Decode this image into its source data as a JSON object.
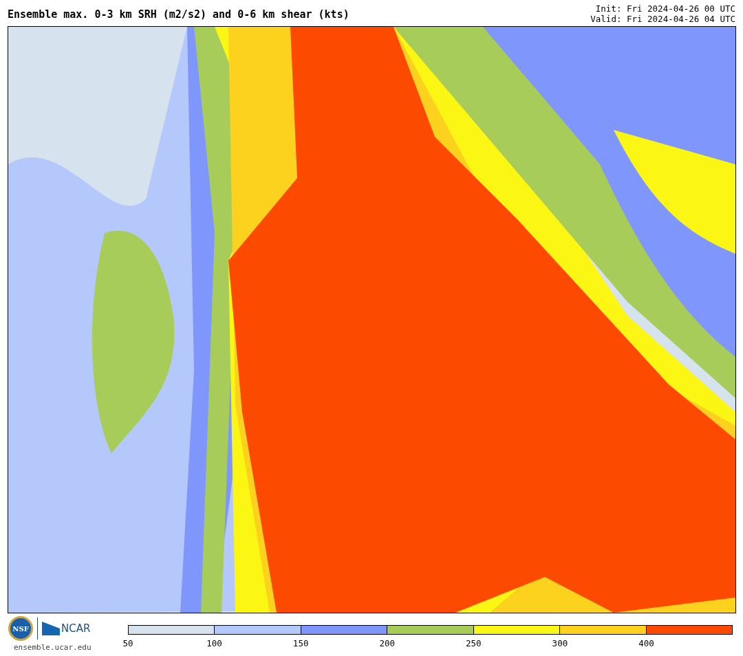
{
  "title": "Ensemble max. 0-3 km SRH (m2/s2) and 0-6 km shear (kts)",
  "init": "Init: Fri 2024-04-26 00 UTC",
  "valid": "Valid: Fri 2024-04-26 04 UTC",
  "logos": {
    "nsf": "NSF",
    "ncar": "NCAR",
    "url": "ensemble.ucar.edu"
  },
  "colorbar": [
    {
      "label": "50",
      "color": "#d6e2ee"
    },
    {
      "label": "100",
      "color": "#b4c8fc"
    },
    {
      "label": "150",
      "color": "#7f96fc"
    },
    {
      "label": "200",
      "color": "#a8cc5a"
    },
    {
      "label": "250",
      "color": "#fcf614"
    },
    {
      "label": "300",
      "color": "#fcd21e"
    },
    {
      "label": "400",
      "color": "#fc4a00"
    }
  ]
}
